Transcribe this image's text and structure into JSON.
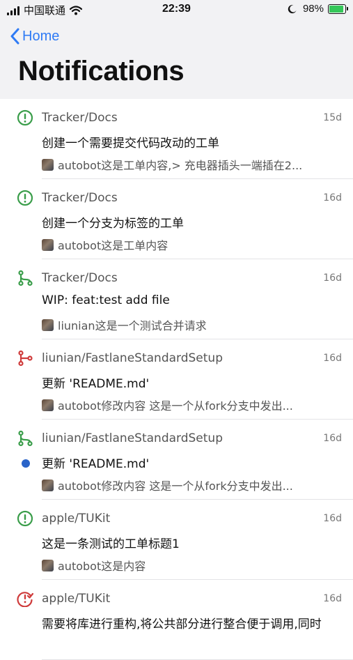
{
  "status_bar": {
    "carrier": "中国联通",
    "time": "22:39",
    "battery": "98%",
    "battery_level": 0.98
  },
  "nav": {
    "back_label": "Home",
    "title": "Notifications"
  },
  "notifications": [
    {
      "repo": "Tracker/Docs",
      "date": "15d",
      "title": "创建一个需要提交代码改动的工单",
      "subtitle": "autobot这是工单内容,> 充电器插头一端插在2...",
      "icon": "issue-open-icon",
      "icon_color": "#3a9d4a",
      "unread": false
    },
    {
      "repo": "Tracker/Docs",
      "date": "16d",
      "title": "创建一个分支为标签的工单",
      "subtitle": "autobot这是工单内容",
      "icon": "issue-open-icon",
      "icon_color": "#3a9d4a",
      "unread": false
    },
    {
      "repo": "Tracker/Docs",
      "date": "16d",
      "title": "WIP: feat:test add file",
      "subtitle": "liunian这是一个测试合并请求",
      "icon": "pull-request-icon",
      "icon_color": "#3a9d4a",
      "unread": false
    },
    {
      "repo": "liunian/FastlaneStandardSetup",
      "date": "16d",
      "title": "更新 'README.md'",
      "subtitle": "autobot修改内容 这是一个从fork分支中发出...",
      "icon": "pull-request-closed-icon",
      "icon_color": "#cf3b3b",
      "unread": false
    },
    {
      "repo": "liunian/FastlaneStandardSetup",
      "date": "16d",
      "title": "更新 'README.md'",
      "subtitle": "autobot修改内容 这是一个从fork分支中发出...",
      "icon": "pull-request-icon",
      "icon_color": "#3a9d4a",
      "unread": true
    },
    {
      "repo": "apple/TUKit",
      "date": "16d",
      "title": "这是一条测试的工单标题1",
      "subtitle": "autobot这是内容",
      "icon": "issue-open-icon",
      "icon_color": "#3a9d4a",
      "unread": false
    },
    {
      "repo": "apple/TUKit",
      "date": "16d",
      "title": "需要将库进行重构,将公共部分进行整合便于调用,同时",
      "subtitle": "",
      "icon": "issue-closed-icon",
      "icon_color": "#cf3b3b",
      "unread": false
    }
  ]
}
